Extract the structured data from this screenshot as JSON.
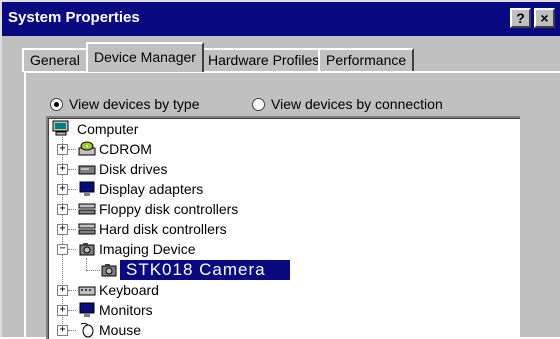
{
  "window": {
    "title": "System Properties",
    "help_button": "?",
    "close_button": "×"
  },
  "tabs": [
    {
      "label": "General"
    },
    {
      "label": "Device Manager"
    },
    {
      "label": "Hardware Profiles"
    },
    {
      "label": "Performance"
    }
  ],
  "view_options": {
    "by_type": "View devices by type",
    "by_connection": "View devices by connection",
    "selected": "by_type"
  },
  "tree": {
    "root": "Computer",
    "items": [
      {
        "label": "CDROM",
        "icon": "cdrom-icon",
        "expanded": false
      },
      {
        "label": "Disk drives",
        "icon": "disk-drive-icon",
        "expanded": false
      },
      {
        "label": "Display adapters",
        "icon": "display-adapter-icon",
        "expanded": false
      },
      {
        "label": "Floppy disk controllers",
        "icon": "floppy-controller-icon",
        "expanded": false
      },
      {
        "label": "Hard disk controllers",
        "icon": "hard-disk-controller-icon",
        "expanded": false
      },
      {
        "label": "Imaging Device",
        "icon": "imaging-device-icon",
        "expanded": true
      },
      {
        "label": "Keyboard",
        "icon": "keyboard-icon",
        "expanded": false
      },
      {
        "label": "Monitors",
        "icon": "monitor-icon",
        "expanded": false
      },
      {
        "label": "Mouse",
        "icon": "mouse-icon",
        "expanded": false
      }
    ],
    "selected_child": "STK018 Camera"
  }
}
